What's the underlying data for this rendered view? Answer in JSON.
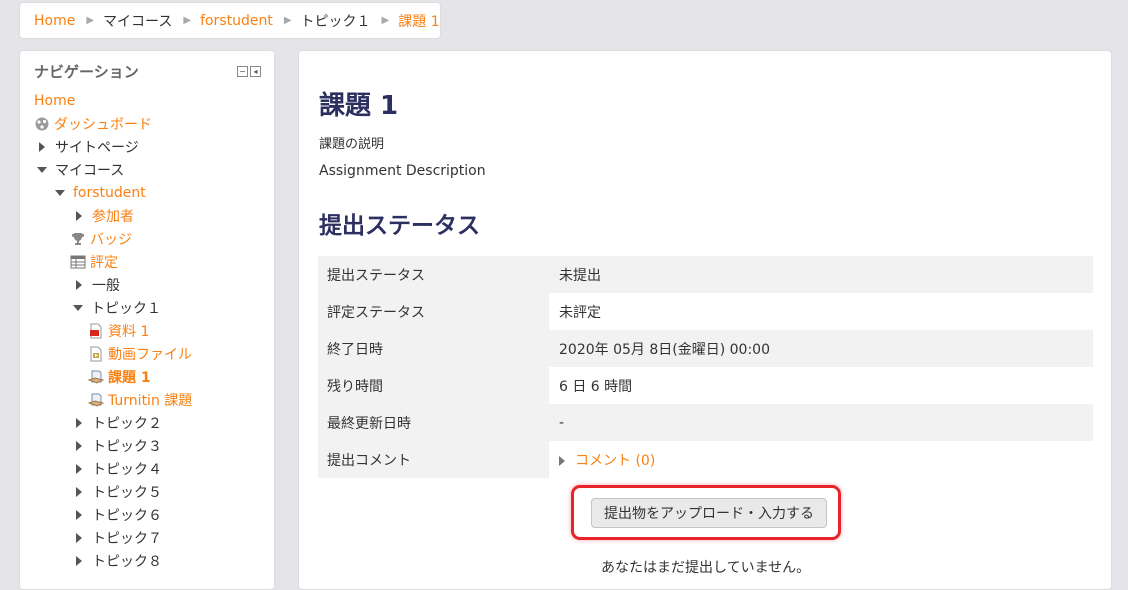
{
  "breadcrumb": {
    "items": [
      {
        "label": "Home"
      },
      {
        "label": "マイコース"
      },
      {
        "label": "forstudent"
      },
      {
        "label": "トピック１"
      },
      {
        "label": "課題 1"
      }
    ]
  },
  "navigation": {
    "title": "ナビゲーション",
    "items": [
      {
        "label": "Home"
      },
      {
        "label": "ダッシュボード",
        "icon": "dashboard-icon"
      },
      {
        "label": "サイトページ"
      },
      {
        "label": "マイコース"
      },
      {
        "label": "forstudent"
      },
      {
        "label": "参加者"
      },
      {
        "label": "バッジ",
        "icon": "trophy-icon"
      },
      {
        "label": "評定",
        "icon": "grades-table-icon"
      },
      {
        "label": "一般"
      },
      {
        "label": "トピック１"
      },
      {
        "label": "資料 1",
        "icon": "pdf-file-icon"
      },
      {
        "label": "動画ファイル",
        "icon": "video-file-icon"
      },
      {
        "label": "課題 1",
        "icon": "assignment-icon"
      },
      {
        "label": "Turnitin 課題",
        "icon": "turnitin-icon"
      },
      {
        "label": "トピック２"
      },
      {
        "label": "トピック３"
      },
      {
        "label": "トピック４"
      },
      {
        "label": "トピック５"
      },
      {
        "label": "トピック６"
      },
      {
        "label": "トピック７"
      },
      {
        "label": "トピック８"
      }
    ]
  },
  "main": {
    "title": "課題 1",
    "description_label": "課題の説明",
    "description": "Assignment Description",
    "status_heading": "提出ステータス",
    "status_rows": [
      {
        "label": "提出ステータス",
        "value": "未提出"
      },
      {
        "label": "評定ステータス",
        "value": "未評定"
      },
      {
        "label": "終了日時",
        "value": "2020年 05月 8日(金曜日) 00:00"
      },
      {
        "label": "残り時間",
        "value": "6 日 6 時間"
      },
      {
        "label": "最終更新日時",
        "value": "-"
      },
      {
        "label": "提出コメント",
        "value": "コメント (0)"
      }
    ],
    "upload_button": "提出物をアップロード・入力する",
    "not_submitted_text": "あなたはまだ提出していません。"
  },
  "colors": {
    "accent": "#f98012",
    "heading": "#2c3060",
    "highlight": "#e8232a"
  }
}
